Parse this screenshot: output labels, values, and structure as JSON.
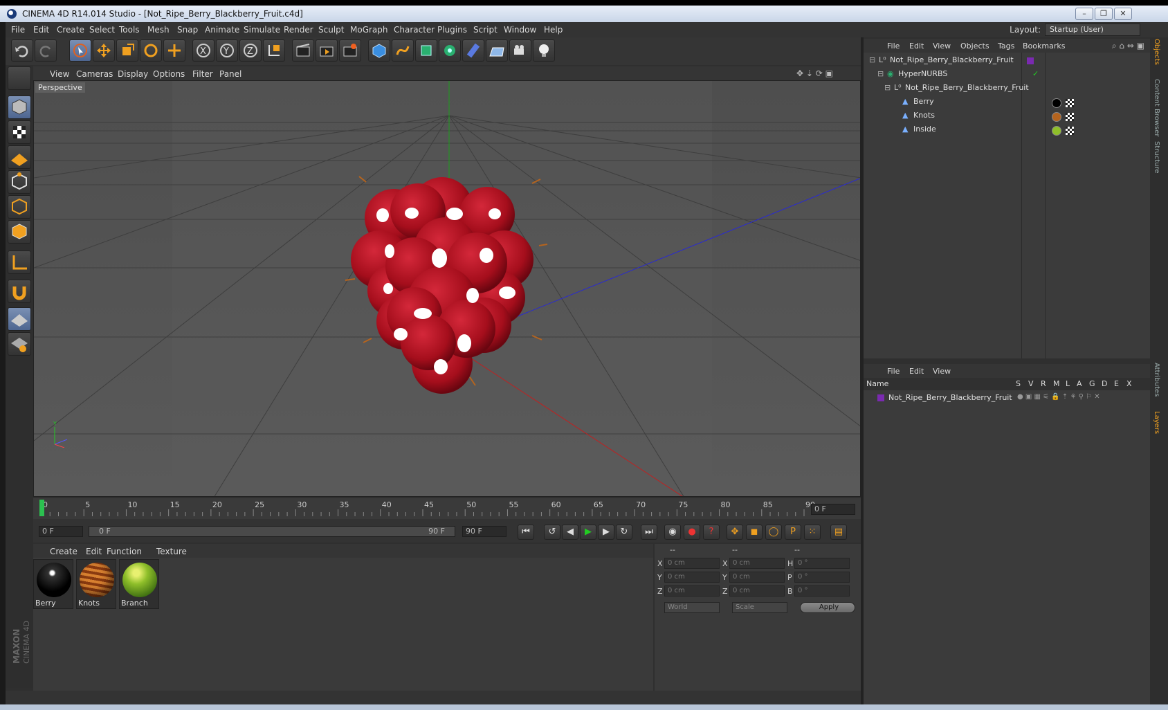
{
  "window": {
    "title": "CINEMA 4D R14.014 Studio - [Not_Ripe_Berry_Blackberry_Fruit.c4d]"
  },
  "menubar": {
    "items": [
      "File",
      "Edit",
      "Create",
      "Select",
      "Tools",
      "Mesh",
      "Snap",
      "Animate",
      "Simulate",
      "Render",
      "Sculpt",
      "MoGraph",
      "Character",
      "Plugins",
      "Script",
      "Window",
      "Help"
    ],
    "layout_label": "Layout:",
    "layout_value": "Startup (User)"
  },
  "viewport": {
    "menu": [
      "View",
      "Cameras",
      "Display",
      "Options",
      "Filter",
      "Panel"
    ],
    "label": "Perspective"
  },
  "timeline": {
    "ticks": [
      "0",
      "5",
      "10",
      "15",
      "20",
      "25",
      "30",
      "35",
      "40",
      "45",
      "50",
      "55",
      "60",
      "65",
      "70",
      "75",
      "80",
      "85",
      "90"
    ],
    "frame_display": "0 F"
  },
  "transport": {
    "start": "0 F",
    "range_start": "0 F",
    "range_end": "90 F",
    "end": "90 F"
  },
  "material_manager": {
    "menu": [
      "Create",
      "Edit",
      "Function",
      "Texture"
    ],
    "materials": [
      {
        "name": "Berry",
        "color": "#111111"
      },
      {
        "name": "Knots",
        "color": "#b5641e"
      },
      {
        "name": "Branch",
        "color": "#8fbf2a"
      }
    ]
  },
  "coordinates": {
    "headers": [
      "--",
      "--",
      "--"
    ],
    "rows": [
      {
        "a": "X",
        "a_val": "0 cm",
        "b": "X",
        "b_val": "0 cm",
        "c": "H",
        "c_val": "0 °"
      },
      {
        "a": "Y",
        "a_val": "0 cm",
        "b": "Y",
        "b_val": "0 cm",
        "c": "P",
        "c_val": "0 °"
      },
      {
        "a": "Z",
        "a_val": "0 cm",
        "b": "Z",
        "b_val": "0 cm",
        "c": "B",
        "c_val": "0 °"
      }
    ],
    "mode1": "World",
    "mode2": "Scale",
    "apply": "Apply"
  },
  "object_manager": {
    "menu": [
      "File",
      "Edit",
      "View",
      "Objects",
      "Tags",
      "Bookmarks"
    ],
    "objects": [
      {
        "name": "Not_Ripe_Berry_Blackberry_Fruit",
        "indent": 0
      },
      {
        "name": "HyperNURBS",
        "indent": 1
      },
      {
        "name": "Not_Ripe_Berry_Blackberry_Fruit",
        "indent": 2
      },
      {
        "name": "Berry",
        "indent": 3
      },
      {
        "name": "Knots",
        "indent": 3
      },
      {
        "name": "Inside",
        "indent": 3
      }
    ]
  },
  "layer_manager": {
    "menu": [
      "File",
      "Edit",
      "View"
    ],
    "columns": [
      "Name",
      "S",
      "V",
      "R",
      "M",
      "L",
      "A",
      "G",
      "D",
      "E",
      "X"
    ],
    "layers": [
      {
        "name": "Not_Ripe_Berry_Blackberry_Fruit"
      }
    ]
  },
  "side_tabs": [
    "Objects",
    "Content Browser",
    "Structure",
    "Attributes",
    "Layers"
  ],
  "brand": {
    "line1": "MAXON",
    "line2": "CINEMA 4D"
  },
  "colors": {
    "accent": "#7a90b4",
    "berry": "#b3101e"
  }
}
